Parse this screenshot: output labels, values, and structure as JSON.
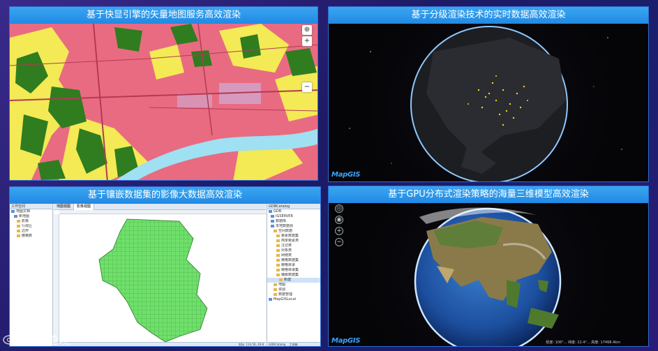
{
  "panels": [
    {
      "title": "基于快显引擎的矢量地图服务高效渲染"
    },
    {
      "title": "基于分级渲染技术的实时数据高效渲染",
      "logo": "MapGIS"
    },
    {
      "title": "基于镶嵌数据集的影像大数据高效渲染",
      "left_header": "工作空间",
      "right_header": "GDBCatalog",
      "tabs": [
        "地图视图",
        "影像视图"
      ],
      "tree_left": [
        "地图文档",
        "新地图",
        "影像",
        "行政区",
        "边界",
        "栅格数"
      ],
      "tree_right": [
        "GDB",
        "IGSERVER",
        "数据库",
        "本地数据源",
        "空间数据",
        "要素数据集",
        "简单要素类",
        "注记类",
        "对象类",
        "网络类",
        "栅格数据集",
        "栅格目录",
        "栅格目录集",
        "镶嵌数据集",
        "新建",
        "地图",
        "资源",
        "数据管理",
        "MapGISLocal"
      ],
      "status_text": "坐标: 114.56, 29.8",
      "right_bottom_tabs": [
        "GDBCatalog",
        "工具箱"
      ]
    },
    {
      "title": "基于GPU分布式渲染策略的海量三维模型高效渲染",
      "logo": "MapGIS",
      "coords_text": "经度: 106°... 纬度: 22.4°... 高度: 17468.4km"
    }
  ],
  "brand": {
    "text": "大数踏境"
  },
  "colors": {
    "title_bar": "#2189e4",
    "map_pink": "#e96b81",
    "map_green": "#2f7d1f",
    "map_yellow": "#f3ea55",
    "river": "#9fe0f3",
    "mosaic_green": "#6fe06b",
    "city_dots": "#ffd21c"
  },
  "icons": {
    "compass": "compass-icon",
    "zoom_in": "plus-icon",
    "zoom_out": "minus-icon",
    "brand_logo": "weibo-icon"
  }
}
